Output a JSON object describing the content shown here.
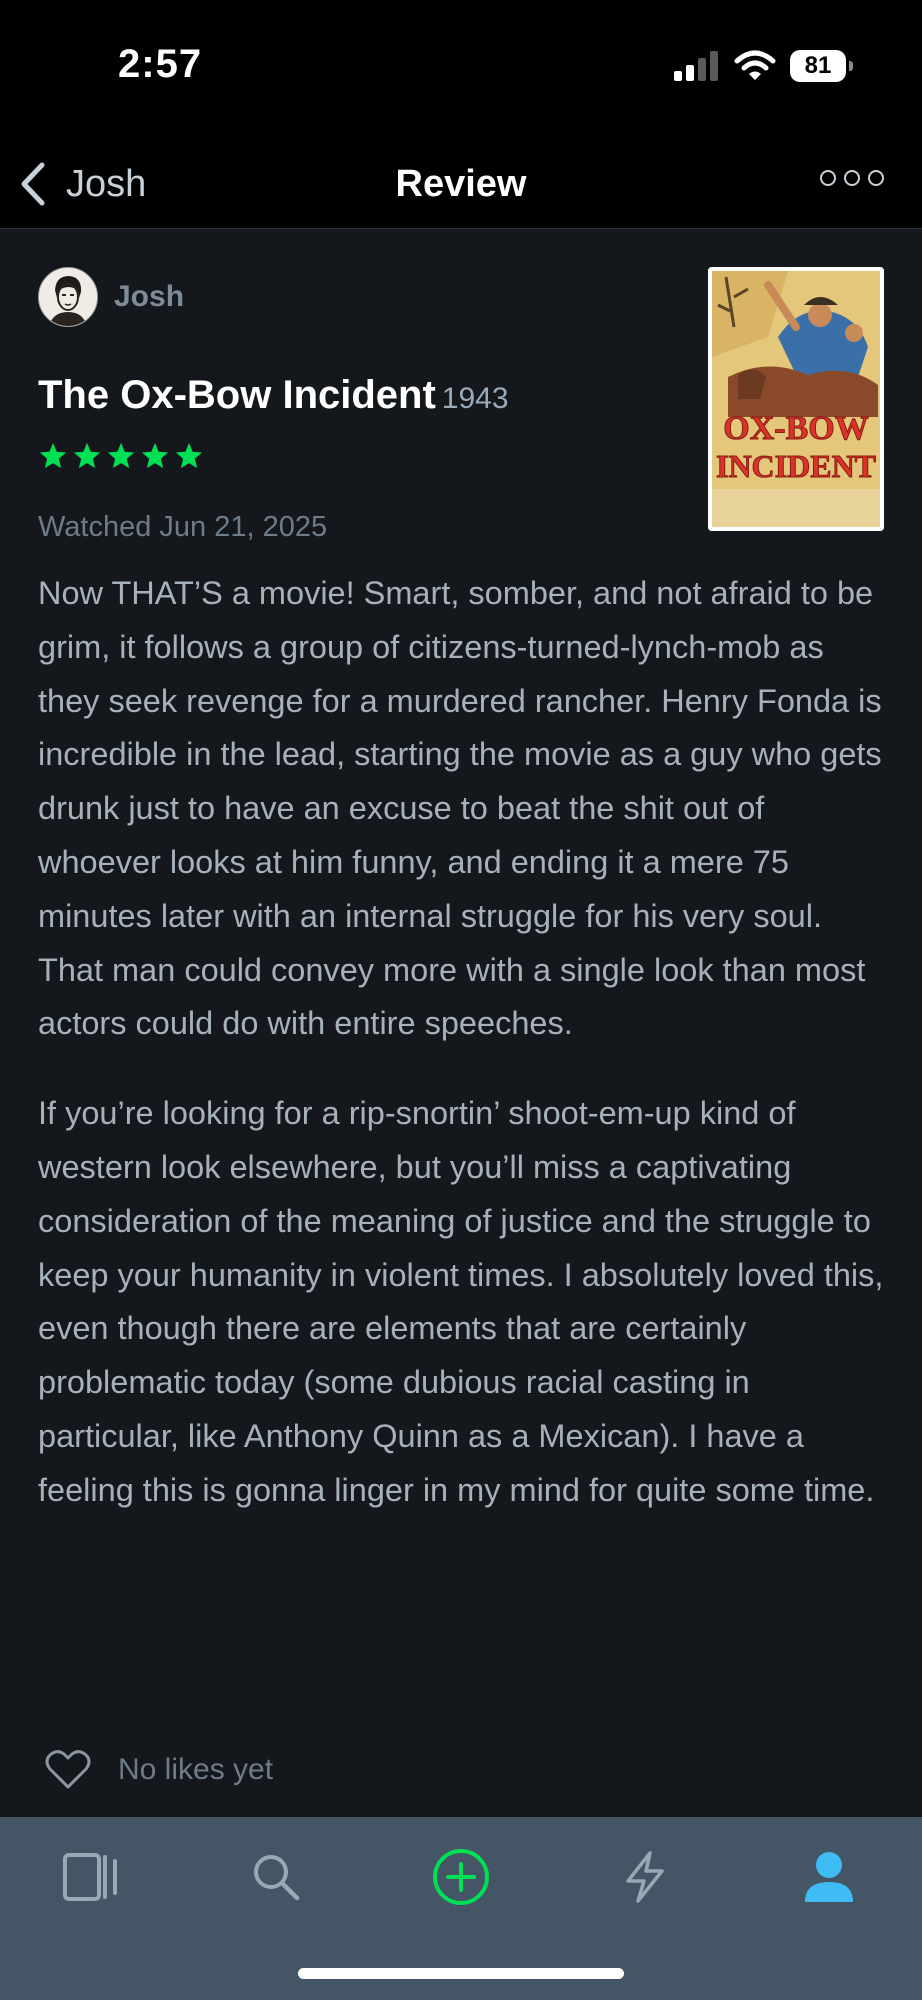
{
  "status_bar": {
    "time": "2:57",
    "battery": "81"
  },
  "nav": {
    "back_label": "Josh",
    "title": "Review"
  },
  "review": {
    "author": "Josh",
    "film_title": "The Ox-Bow Incident",
    "year": "1943",
    "rating_stars": 5,
    "star_color": "#00e054",
    "watched": "Watched Jun 21, 2025",
    "paragraphs": [
      "Now THAT’S a movie! Smart, somber, and not afraid to be grim, it follows a group of citizens-turned-lynch-mob as they seek revenge for a murdered rancher. Henry Fonda is incredible in the lead, starting the movie as a guy who gets drunk just to have an excuse to beat the shit out of whoever looks at him funny, and ending it a mere 75 minutes later with an internal struggle for his very soul. That man could convey more with a single look than most actors could do with entire speeches.",
      "If you’re looking for a rip-snortin’ shoot-em-up kind of western look elsewhere, but you’ll miss a captivating consideration of the meaning of justice and the struggle to keep your humanity in violent times. I absolutely loved this, even though there are elements that are certainly problematic today (some dubious racial casting in particular, like Anthony Quinn as a Mexican). I have a feeling this is gonna linger in my mind for quite some time."
    ],
    "likes_text": "No likes yet",
    "poster_text": [
      "OX-BOW",
      "INCIDENT"
    ]
  },
  "tab_bar": {
    "tabs": [
      {
        "icon": "films-icon"
      },
      {
        "icon": "search-icon"
      },
      {
        "icon": "add-icon",
        "color": "#00e054"
      },
      {
        "icon": "activity-icon"
      },
      {
        "icon": "profile-icon",
        "color": "#40bcf4",
        "active": true
      }
    ]
  }
}
